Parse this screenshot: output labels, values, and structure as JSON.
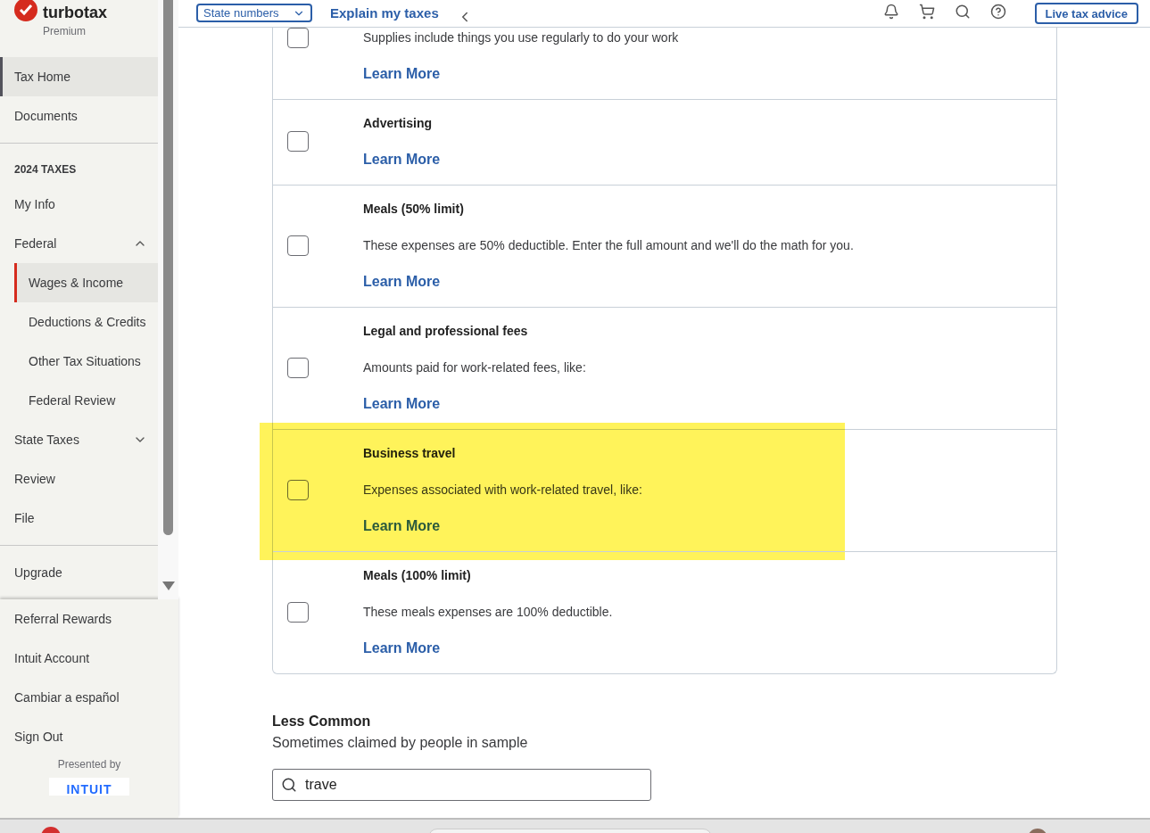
{
  "sidebar": {
    "logo": {
      "name": "turbotax",
      "edition": "Premium"
    },
    "top_items": [
      {
        "label": "Tax Home",
        "selected": true
      },
      {
        "label": "Documents",
        "selected": false
      }
    ],
    "section_heading": "2024 TAXES",
    "nav": [
      {
        "label": "My Info",
        "selected": false
      },
      {
        "label": "Federal",
        "selected": false,
        "expanded": true,
        "children": [
          {
            "label": "Wages & Income",
            "selected": true
          },
          {
            "label": "Deductions & Credits",
            "selected": false
          },
          {
            "label": "Other Tax Situations",
            "selected": false
          },
          {
            "label": "Federal Review",
            "selected": false
          }
        ]
      },
      {
        "label": "State Taxes",
        "selected": false,
        "expanded": false
      },
      {
        "label": "Review",
        "selected": false
      },
      {
        "label": "File",
        "selected": false
      }
    ],
    "upgrade": "Upgrade",
    "bottom_items": [
      {
        "label": "Referral Rewards"
      },
      {
        "label": "Intuit Account"
      },
      {
        "label": "Cambiar a español"
      },
      {
        "label": "Sign Out"
      }
    ],
    "presented_by": "Presented by",
    "partner_logo": "INTUIT"
  },
  "top_bar": {
    "dropdown": "State numbers",
    "link": "Explain my taxes",
    "button": "Live tax advice"
  },
  "expenses": [
    {
      "description": "Supplies include things you use regularly to do your work",
      "link": "Learn More",
      "checked": false,
      "highlighted": false
    },
    {
      "title": "Advertising",
      "link": "Learn More",
      "checked": false,
      "highlighted": false
    },
    {
      "title": "Meals (50% limit)",
      "description": "These expenses are 50% deductible. Enter the full amount and we'll do the math for you.",
      "link": "Learn More",
      "checked": false,
      "highlighted": false
    },
    {
      "title": "Legal and professional fees",
      "description": "Amounts paid for work-related fees, like:",
      "link": "Learn More",
      "checked": false,
      "highlighted": false
    },
    {
      "title": "Business travel",
      "description": "Expenses associated with work-related travel, like:",
      "link": "Learn More",
      "checked": false,
      "highlighted": true
    },
    {
      "title": "Meals (100% limit)",
      "description": "These meals expenses are 100% deductible.",
      "link": "Learn More",
      "checked": false,
      "highlighted": false
    }
  ],
  "less_common": {
    "title": "Less Common",
    "subtitle": "Sometimes claimed by people in sample",
    "search_value": "trave"
  }
}
